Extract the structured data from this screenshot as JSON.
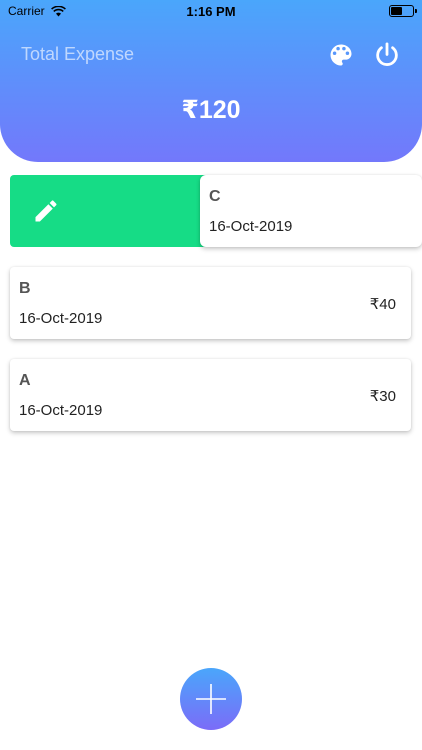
{
  "status_bar": {
    "carrier": "Carrier",
    "time": "1:16 PM",
    "battery_level": 0.5
  },
  "header": {
    "title": "Total Expense",
    "total": "₹120",
    "palette_icon": "palette-icon",
    "power_icon": "power-icon"
  },
  "colors": {
    "gradient_top": "#4aa6fb",
    "gradient_bottom": "#7378fb",
    "edit_action": "#16dc86"
  },
  "expenses": [
    {
      "name": "C",
      "date": "16-Oct-2019",
      "amount": ""
    },
    {
      "name": "B",
      "date": "16-Oct-2019",
      "amount": "₹40"
    },
    {
      "name": "A",
      "date": "16-Oct-2019",
      "amount": "₹30"
    }
  ],
  "swipe_action": {
    "icon": "pencil-icon"
  },
  "fab": {
    "icon": "plus-icon"
  }
}
